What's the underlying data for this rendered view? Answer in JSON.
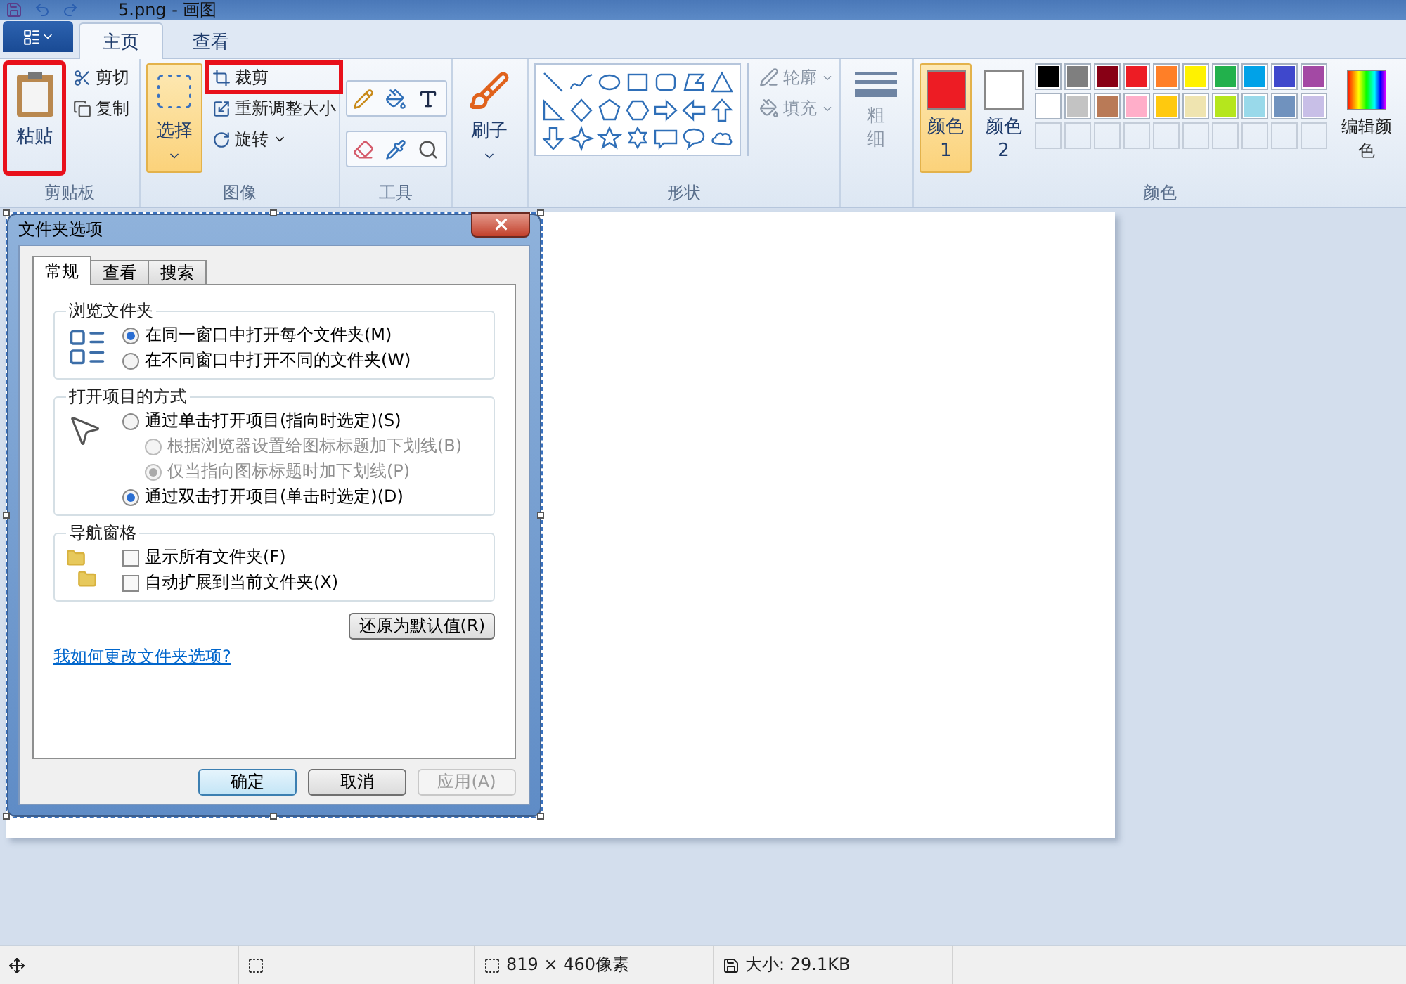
{
  "title_bar": {
    "title": "5.png - 画图"
  },
  "tabs": [
    {
      "label": "主页",
      "selected": true
    },
    {
      "label": "查看",
      "selected": false
    }
  ],
  "clipboard": {
    "label": "剪贴板",
    "paste": {
      "label": "粘贴",
      "highlighted": true
    },
    "cut": "剪切",
    "copy": "复制"
  },
  "image": {
    "label": "图像",
    "select": {
      "label": "选择",
      "selected": true
    },
    "crop": {
      "label": "裁剪",
      "highlighted": true
    },
    "resize": "重新调整大小",
    "rotate": "旋转"
  },
  "tools": {
    "label": "工具"
  },
  "brushes": {
    "label": "刷子"
  },
  "shapes": {
    "label": "形状",
    "outline": "轮廓",
    "fill": "填充"
  },
  "size": {
    "label": "粗细"
  },
  "colors": {
    "label": "颜色",
    "edit": "编辑颜色",
    "slots": [
      {
        "label": "颜色 1",
        "selected": true,
        "color": "#ed1c24"
      },
      {
        "label": "颜色 2",
        "selected": false,
        "color": "#ffffff"
      }
    ],
    "palette": [
      {
        "kind": "swatch",
        "color": "#000000"
      },
      {
        "kind": "swatch",
        "color": "#7f7f7f"
      },
      {
        "kind": "swatch",
        "color": "#880015"
      },
      {
        "kind": "swatch",
        "color": "#ed1c24"
      },
      {
        "kind": "swatch",
        "color": "#ff7f27"
      },
      {
        "kind": "swatch",
        "color": "#fff200"
      },
      {
        "kind": "swatch",
        "color": "#22b14c"
      },
      {
        "kind": "swatch",
        "color": "#00a2e8"
      },
      {
        "kind": "swatch",
        "color": "#3f48cc"
      },
      {
        "kind": "swatch",
        "color": "#a349a4"
      },
      {
        "kind": "swatch",
        "color": "#ffffff"
      },
      {
        "kind": "swatch",
        "color": "#c3c3c3"
      },
      {
        "kind": "swatch",
        "color": "#b97a57"
      },
      {
        "kind": "swatch",
        "color": "#ffaec9"
      },
      {
        "kind": "swatch",
        "color": "#ffc90e"
      },
      {
        "kind": "swatch",
        "color": "#efe4b0"
      },
      {
        "kind": "swatch",
        "color": "#b5e61d"
      },
      {
        "kind": "swatch",
        "color": "#99d9ea"
      },
      {
        "kind": "swatch",
        "color": "#7092be"
      },
      {
        "kind": "swatch",
        "color": "#c8bfe7"
      },
      {
        "kind": "empty"
      },
      {
        "kind": "empty"
      },
      {
        "kind": "empty"
      },
      {
        "kind": "empty"
      },
      {
        "kind": "empty"
      },
      {
        "kind": "empty"
      },
      {
        "kind": "empty"
      },
      {
        "kind": "empty"
      },
      {
        "kind": "empty"
      },
      {
        "kind": "empty"
      }
    ]
  },
  "dialog": {
    "title": "文件夹选项",
    "tabs": [
      {
        "label": "常规",
        "selected": true
      },
      {
        "label": "查看",
        "selected": false
      },
      {
        "label": "搜索",
        "selected": false
      }
    ],
    "sections": [
      {
        "title": "浏览文件夹",
        "kind": "radio",
        "items": [
          {
            "label": "在同一窗口中打开每个文件夹(M)",
            "selected": true,
            "disabled": false
          },
          {
            "label": "在不同窗口中打开不同的文件夹(W)",
            "selected": false,
            "disabled": false
          }
        ]
      },
      {
        "title": "打开项目的方式",
        "kind": "radio",
        "items": [
          {
            "label": "通过单击打开项目(指向时选定)(S)",
            "selected": false,
            "disabled": false,
            "children": [
              {
                "label": "根据浏览器设置给图标标题加下划线(B)",
                "selected": false,
                "disabled": true
              },
              {
                "label": "仅当指向图标标题时加下划线(P)",
                "selected": true,
                "disabled": true
              }
            ]
          },
          {
            "label": "通过双击打开项目(单击时选定)(D)",
            "selected": true,
            "disabled": false
          }
        ]
      },
      {
        "title": "导航窗格",
        "kind": "checkbox",
        "items": [
          {
            "label": "显示所有文件夹(F)",
            "checked": false
          },
          {
            "label": "自动扩展到当前文件夹(X)",
            "checked": false
          }
        ]
      }
    ],
    "restore_button": "还原为默认值(R)",
    "help_link": "我如何更改文件夹选项?",
    "buttons": [
      {
        "label": "确定",
        "default": true,
        "disabled": false
      },
      {
        "label": "取消",
        "default": false,
        "disabled": false
      },
      {
        "label": "应用(A)",
        "default": false,
        "disabled": true
      }
    ]
  },
  "status_bar": {
    "dimensions": "819 × 460像素",
    "size": "大小: 29.1KB"
  }
}
